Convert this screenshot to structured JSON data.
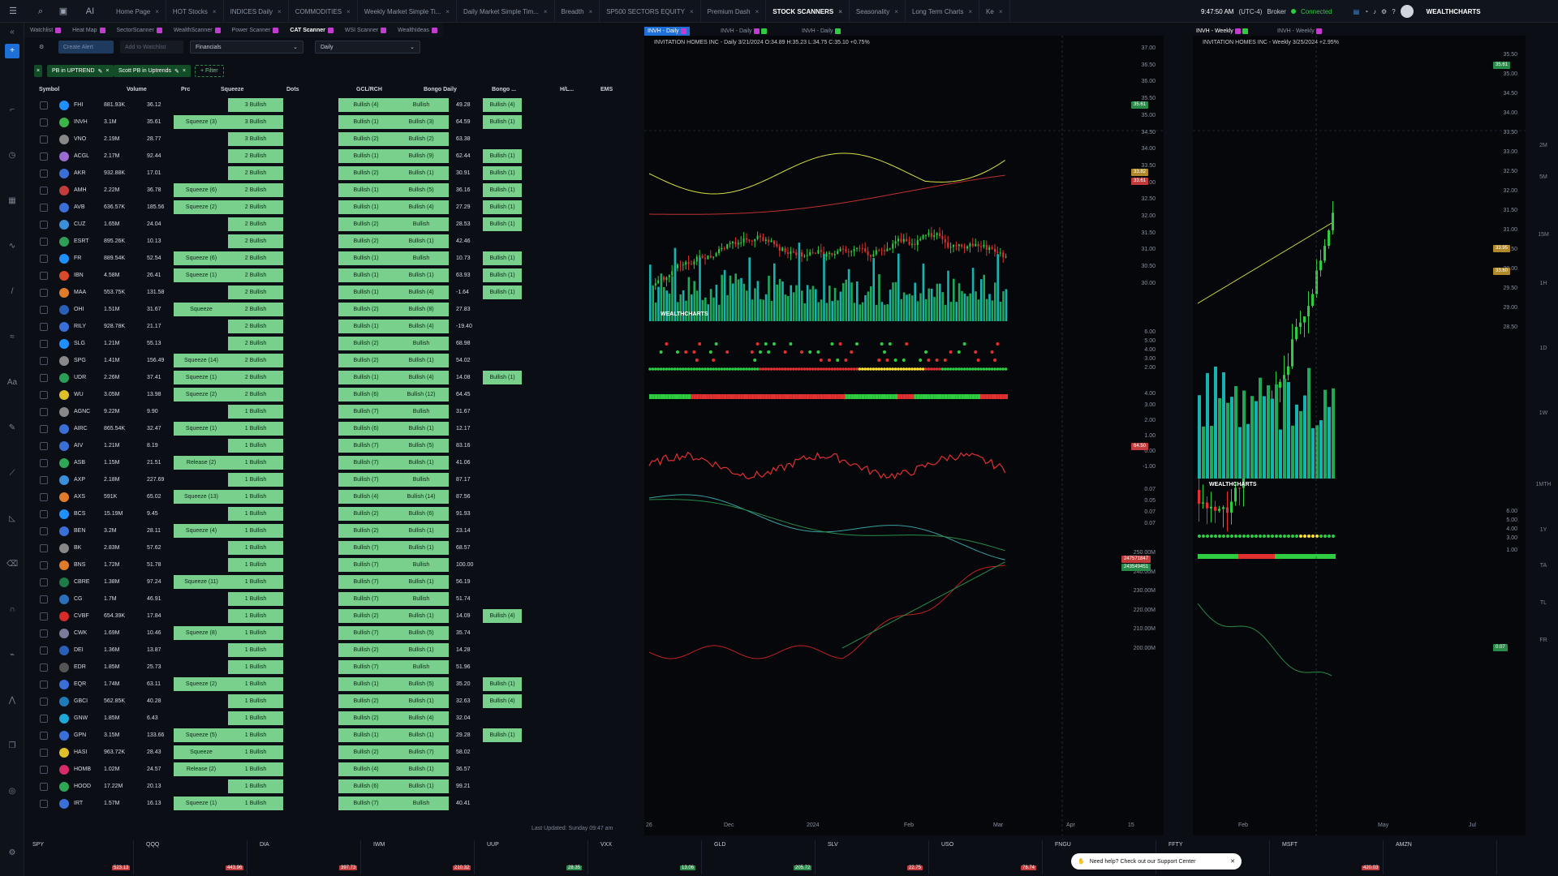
{
  "topbar": {
    "tabs": [
      "Home Page",
      "HOT Stocks",
      "INDICES Daily",
      "COMMODITIES",
      "Weekly Market Simple Ti...",
      "Daily Market Simple Tim...",
      "Breadth",
      "SP500 SECTORS EQUITY",
      "Premium Dash",
      "STOCK SCANNERS",
      "Seasonality",
      "Long Term Charts",
      "Ke"
    ],
    "active": "STOCK SCANNERS",
    "time": "9:47:50 AM",
    "tz": "(UTC-4)",
    "broker": "Broker",
    "connected": "Connected",
    "brand": "WEALTHCHARTS"
  },
  "subtabs": [
    {
      "label": "Watchlist",
      "color": "#c23ccf"
    },
    {
      "label": "Heat Map",
      "color": "#c23ccf"
    },
    {
      "label": "SectorScanner",
      "color": "#c23ccf"
    },
    {
      "label": "WealthScanner",
      "color": "#c23ccf"
    },
    {
      "label": "Power Scanner",
      "color": "#c23ccf"
    },
    {
      "label": "CAT Scanner",
      "color": "#c23ccf",
      "active": true
    },
    {
      "label": "WSI Scanner",
      "color": "#c23ccf"
    },
    {
      "label": "WealthIdeas",
      "color": "#c23ccf"
    }
  ],
  "scanbar": {
    "create_alert": "Create Alert",
    "add_watchlist": "Add to Watchlist",
    "sector": "Financials",
    "timeframe": "Daily"
  },
  "filters": [
    {
      "label": "PB in UPTREND"
    },
    {
      "label": "Scott PB in Uptrends"
    }
  ],
  "add_filter": "+ Filter",
  "table": {
    "headers": [
      "Symbol",
      "Volume",
      "Prc",
      "Squeeze",
      "Dots",
      "GCL/RCH",
      "Bongo Daily",
      "Bongo ...",
      "H/L...",
      "EMS"
    ],
    "rows": [
      [
        "FHI",
        "881.93K",
        "36.12",
        "",
        "3 Bullish",
        "",
        "Bullish (4)",
        "Bullish",
        "49.28",
        "Bullish (4)"
      ],
      [
        "INVH",
        "3.1M",
        "35.61",
        "Squeeze (3)",
        "3 Bullish",
        "",
        "Bullish (1)",
        "Bullish (3)",
        "64.59",
        "Bullish (1)"
      ],
      [
        "VNO",
        "2.19M",
        "28.77",
        "",
        "3 Bullish",
        "",
        "Bullish (2)",
        "Bullish (2)",
        "63.38",
        ""
      ],
      [
        "ACGL",
        "2.17M",
        "92.44",
        "",
        "2 Bullish",
        "",
        "Bullish (1)",
        "Bullish (9)",
        "62.44",
        "Bullish (1)"
      ],
      [
        "AKR",
        "932.88K",
        "17.01",
        "",
        "2 Bullish",
        "",
        "Bullish (2)",
        "Bullish (1)",
        "30.91",
        "Bullish (1)"
      ],
      [
        "AMH",
        "2.22M",
        "36.78",
        "Squeeze (6)",
        "2 Bullish",
        "",
        "Bullish (1)",
        "Bullish (5)",
        "36.16",
        "Bullish (1)"
      ],
      [
        "AVB",
        "636.57K",
        "185.56",
        "Squeeze (2)",
        "2 Bullish",
        "",
        "Bullish (1)",
        "Bullish (4)",
        "27.29",
        "Bullish (1)"
      ],
      [
        "CUZ",
        "1.65M",
        "24.04",
        "",
        "2 Bullish",
        "",
        "Bullish (2)",
        "Bullish",
        "28.53",
        "Bullish (1)"
      ],
      [
        "ESRT",
        "895.26K",
        "10.13",
        "",
        "2 Bullish",
        "",
        "Bullish (2)",
        "Bullish (1)",
        "42.46",
        ""
      ],
      [
        "FR",
        "889.54K",
        "52.54",
        "Squeeze (6)",
        "2 Bullish",
        "",
        "Bullish (1)",
        "Bullish",
        "10.73",
        "Bullish (1)"
      ],
      [
        "IBN",
        "4.58M",
        "26.41",
        "Squeeze (1)",
        "2 Bullish",
        "",
        "Bullish (1)",
        "Bullish (1)",
        "63.93",
        "Bullish (1)"
      ],
      [
        "MAA",
        "553.75K",
        "131.58",
        "",
        "2 Bullish",
        "",
        "Bullish (1)",
        "Bullish (4)",
        "-1.64",
        "Bullish (1)"
      ],
      [
        "OHI",
        "1.51M",
        "31.67",
        "Squeeze",
        "2 Bullish",
        "",
        "Bullish (2)",
        "Bullish (8)",
        "27.83",
        ""
      ],
      [
        "RILY",
        "928.78K",
        "21.17",
        "",
        "2 Bullish",
        "",
        "Bullish (1)",
        "Bullish (4)",
        "-19.40",
        ""
      ],
      [
        "SLG",
        "1.21M",
        "55.13",
        "",
        "2 Bullish",
        "",
        "Bullish (2)",
        "Bullish",
        "68.98",
        ""
      ],
      [
        "SPG",
        "1.41M",
        "156.49",
        "Squeeze (14)",
        "2 Bullish",
        "",
        "Bullish (2)",
        "Bullish (1)",
        "54.02",
        ""
      ],
      [
        "UDR",
        "2.26M",
        "37.41",
        "Squeeze (1)",
        "2 Bullish",
        "",
        "Bullish (1)",
        "Bullish (4)",
        "14.08",
        "Bullish (1)"
      ],
      [
        "WU",
        "3.05M",
        "13.98",
        "Squeeze (2)",
        "2 Bullish",
        "",
        "Bullish (6)",
        "Bullish (12)",
        "64.45",
        ""
      ],
      [
        "AGNC",
        "9.22M",
        "9.90",
        "",
        "1 Bullish",
        "",
        "Bullish (7)",
        "Bullish",
        "31.67",
        ""
      ],
      [
        "AIRC",
        "865.54K",
        "32.47",
        "Squeeze (1)",
        "1 Bullish",
        "",
        "Bullish (6)",
        "Bullish (1)",
        "12.17",
        ""
      ],
      [
        "AIV",
        "1.21M",
        "8.19",
        "",
        "1 Bullish",
        "",
        "Bullish (7)",
        "Bullish (5)",
        "83.16",
        ""
      ],
      [
        "ASB",
        "1.15M",
        "21.51",
        "Release (2)",
        "1 Bullish",
        "",
        "Bullish (7)",
        "Bullish (1)",
        "41.06",
        ""
      ],
      [
        "AXP",
        "2.18M",
        "227.69",
        "",
        "1 Bullish",
        "",
        "Bullish (7)",
        "Bullish",
        "87.17",
        ""
      ],
      [
        "AXS",
        "591K",
        "65.02",
        "Squeeze (13)",
        "1 Bullish",
        "",
        "Bullish (4)",
        "Bullish (14)",
        "87.56",
        ""
      ],
      [
        "BCS",
        "15.19M",
        "9.45",
        "",
        "1 Bullish",
        "",
        "Bullish (2)",
        "Bullish (6)",
        "91.93",
        ""
      ],
      [
        "BEN",
        "3.2M",
        "28.11",
        "Squeeze (4)",
        "1 Bullish",
        "",
        "Bullish (2)",
        "Bullish (1)",
        "23.14",
        ""
      ],
      [
        "BK",
        "2.83M",
        "57.62",
        "",
        "1 Bullish",
        "",
        "Bullish (7)",
        "Bullish (1)",
        "68.57",
        ""
      ],
      [
        "BNS",
        "1.72M",
        "51.78",
        "",
        "1 Bullish",
        "",
        "Bullish (7)",
        "Bullish",
        "100.00",
        ""
      ],
      [
        "CBRE",
        "1.38M",
        "97.24",
        "Squeeze (11)",
        "1 Bullish",
        "",
        "Bullish (7)",
        "Bullish (1)",
        "56.19",
        ""
      ],
      [
        "CG",
        "1.7M",
        "46.91",
        "",
        "1 Bullish",
        "",
        "Bullish (7)",
        "Bullish",
        "51.74",
        ""
      ],
      [
        "CVBF",
        "654.39K",
        "17.84",
        "",
        "1 Bullish",
        "",
        "Bullish (2)",
        "Bullish (1)",
        "14.09",
        "Bullish (4)"
      ],
      [
        "CWK",
        "1.69M",
        "10.46",
        "Squeeze (8)",
        "1 Bullish",
        "",
        "Bullish (7)",
        "Bullish (5)",
        "35.74",
        ""
      ],
      [
        "DEI",
        "1.36M",
        "13.87",
        "",
        "1 Bullish",
        "",
        "Bullish (2)",
        "Bullish (1)",
        "14.28",
        ""
      ],
      [
        "EDR",
        "1.85M",
        "25.73",
        "",
        "1 Bullish",
        "",
        "Bullish (7)",
        "Bullish",
        "51.96",
        ""
      ],
      [
        "EQR",
        "1.74M",
        "63.11",
        "Squeeze (2)",
        "1 Bullish",
        "",
        "Bullish (1)",
        "Bullish (5)",
        "35.20",
        "Bullish (1)"
      ],
      [
        "GBCI",
        "562.85K",
        "40.28",
        "",
        "1 Bullish",
        "",
        "Bullish (2)",
        "Bullish (1)",
        "32.63",
        "Bullish (4)"
      ],
      [
        "GNW",
        "1.85M",
        "6.43",
        "",
        "1 Bullish",
        "",
        "Bullish (2)",
        "Bullish (4)",
        "32.04",
        ""
      ],
      [
        "GPN",
        "3.15M",
        "133.66",
        "Squeeze (5)",
        "1 Bullish",
        "",
        "Bullish (1)",
        "Bullish (1)",
        "29.28",
        "Bullish (1)"
      ],
      [
        "HASI",
        "963.72K",
        "28.43",
        "Squeeze",
        "1 Bullish",
        "",
        "Bullish (2)",
        "Bullish (7)",
        "58.02",
        ""
      ],
      [
        "HOMB",
        "1.02M",
        "24.57",
        "Release (2)",
        "1 Bullish",
        "",
        "Bullish (4)",
        "Bullish (1)",
        "36.57",
        ""
      ],
      [
        "HOOD",
        "17.22M",
        "20.13",
        "",
        "1 Bullish",
        "",
        "Bullish (6)",
        "Bullish (1)",
        "99.21",
        ""
      ],
      [
        "IRT",
        "1.57M",
        "16.13",
        "Squeeze (1)",
        "1 Bullish",
        "",
        "Bullish (7)",
        "Bullish",
        "40.41",
        ""
      ]
    ],
    "logo_colors": [
      "#1e90ff",
      "#3bb44a",
      "#888",
      "#9a6bd0",
      "#3a6fd8",
      "#c23c3c",
      "#3a6fd8",
      "#3a8fd8",
      "#2e9e57",
      "#1e90ff",
      "#d94a2a",
      "#e07b2a",
      "#2a5fb8",
      "#3a6fd8",
      "#1e90ff",
      "#888",
      "#2a9e57",
      "#e0c02a",
      "#888",
      "#3a6fd8",
      "#3a6fd8",
      "#2ea857",
      "#3a8fd8",
      "#e07b2a",
      "#1e90ff",
      "#3a6fd8",
      "#888",
      "#e07b2a",
      "#1e7a47",
      "#2a6fb8",
      "#d92a2a",
      "#7a7a9a",
      "#2a5fb8",
      "#555",
      "#3a6fd8",
      "#1e7ab8",
      "#1ea8d8",
      "#3a6fd8",
      "#e0c02a",
      "#d92a6a",
      "#2ea857",
      "#3a6fd8"
    ],
    "footer": "Last Updated: Sunday 09:47 am"
  },
  "chart_daily": {
    "tab_active": "INVH - Daily",
    "tab2": "INVH - Daily",
    "tab3": "INVH - Daily",
    "title": "INVITATION HOMES INC - Daily 3/21/2024 O:34.89 H:35.23 L:34.75 C:35.10 +0.75%",
    "price_axis": [
      "37.00",
      "36.50",
      "36.00",
      "35.50",
      "35.00",
      "34.50",
      "34.00",
      "33.50",
      "33.00",
      "32.50",
      "32.00",
      "31.50",
      "31.00",
      "30.50",
      "30.00"
    ],
    "last_price": "35.61",
    "price2": "33.82",
    "price3": "33.61",
    "x_labels": [
      "26",
      "Dec",
      "2024",
      "Feb",
      "Mar",
      "Apr",
      "15"
    ],
    "ind_axis": [
      "6.00",
      "5.00",
      "4.00",
      "3.00",
      "2.00",
      "4.00"
    ],
    "rsi_axis": [
      "3.00",
      "2.00",
      "1.00",
      "0.00",
      "-1.00"
    ],
    "rsi_badge": "64.50",
    "mom_axis": [
      "0.07",
      "0.05",
      "0.07",
      "0.07"
    ],
    "obv_axis": [
      "250.00M",
      "240.00M",
      "230.00M",
      "220.00M",
      "210.00M",
      "200.00M"
    ],
    "obv_badge1": "247571847",
    "obv_badge2": "243549451",
    "watermark": "WEALTHCHARTS"
  },
  "chart_weekly": {
    "tab": "INVH - Weekly",
    "tab2": "INVH - Weekly",
    "title": "INVITATION HOMES INC - Weekly 3/25/2024 +2.95%",
    "price_axis": [
      "35.50",
      "35.00",
      "34.50",
      "34.00",
      "33.50",
      "33.00",
      "32.50",
      "32.00",
      "31.50",
      "31.00",
      "30.50",
      "30.00",
      "29.50",
      "29.00",
      "28.50"
    ],
    "last_price": "35.61",
    "price2": "33.95",
    "price3": "33.60",
    "x_labels": [
      "Feb",
      "May",
      "Jul"
    ],
    "ind_axis": [
      "6.00",
      "5.00",
      "4.00",
      "3.00",
      "1.00"
    ],
    "badge_low": "0.07",
    "watermark": "WEALTHCHARTS"
  },
  "right_rail": [
    "2M",
    "5M",
    "15M",
    "1H",
    "1D",
    "1W",
    "1MTH",
    "1Y",
    "TA",
    "TL",
    "FR"
  ],
  "tickers": [
    {
      "sym": "SPY",
      "price": "523.13"
    },
    {
      "sym": "QQQ",
      "price": "443.96"
    },
    {
      "sym": "DIA",
      "price": "397.73"
    },
    {
      "sym": "IWM",
      "price": "210.32"
    },
    {
      "sym": "UUP",
      "price": "28.35"
    },
    {
      "sym": "VXX",
      "price": "13.06"
    },
    {
      "sym": "GLD",
      "price": "205.72"
    },
    {
      "sym": "SLV",
      "price": "22.75"
    },
    {
      "sym": "USO",
      "price": "78.74"
    },
    {
      "sym": "FNGU",
      "price": ""
    },
    {
      "sym": "FFTY",
      "price": ""
    },
    {
      "sym": "MSFT",
      "price": "420.03"
    },
    {
      "sym": "AMZN",
      "price": ""
    }
  ],
  "help": "Need help? Check out our Support Center"
}
